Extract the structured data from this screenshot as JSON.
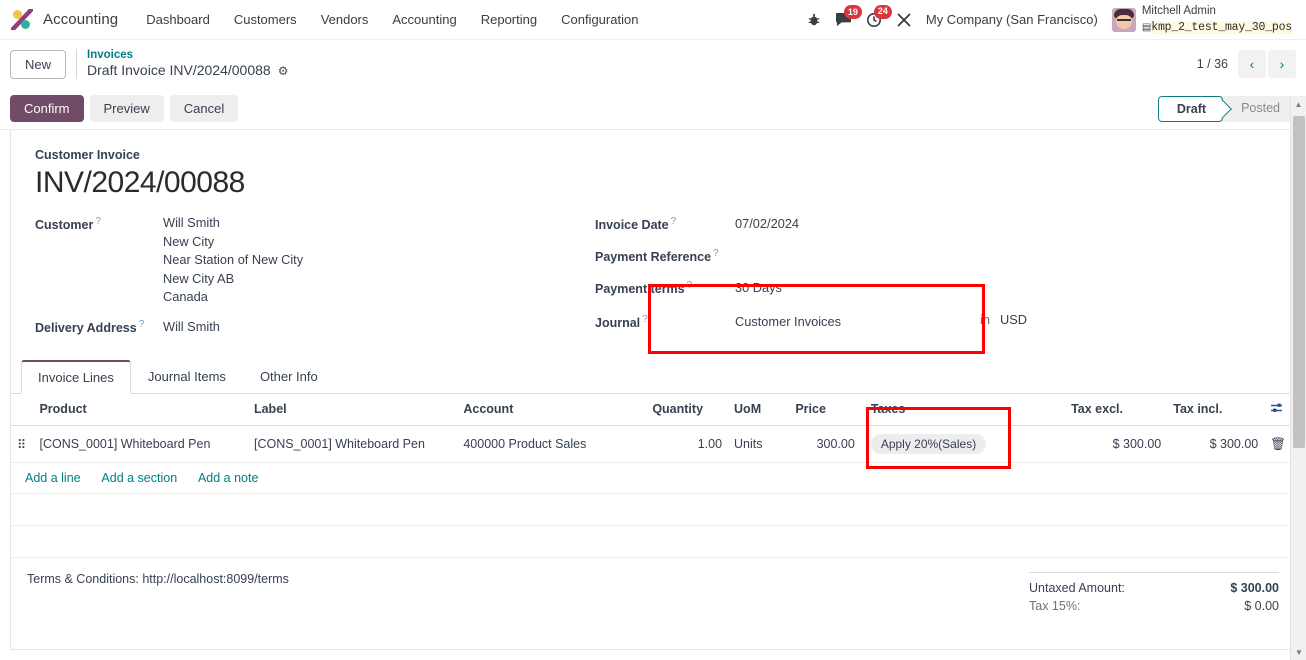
{
  "navbar": {
    "brand": "Accounting",
    "menu": [
      "Dashboard",
      "Customers",
      "Vendors",
      "Accounting",
      "Reporting",
      "Configuration"
    ],
    "icons": {
      "debug": "bug-icon",
      "messages": "chat-icon",
      "activities": "clock-icon",
      "tools": "wrench-icon"
    },
    "messages_count": "19",
    "activities_count": "24",
    "company": "My Company (San Francisco)",
    "user_name": "Mitchell Admin",
    "database": "kmp_2_test_may_30_pos"
  },
  "breadcrumb": {
    "new_label": "New",
    "parent": "Invoices",
    "current": "Draft Invoice INV/2024/00088",
    "settings_icon": "gear-icon"
  },
  "pager": {
    "count": "1 / 36",
    "prev_icon": "chevron-left-icon",
    "next_icon": "chevron-right-icon"
  },
  "actions": {
    "confirm": "Confirm",
    "preview": "Preview",
    "cancel": "Cancel"
  },
  "status": {
    "states": [
      "Draft",
      "Posted"
    ],
    "active": "Draft"
  },
  "invoice": {
    "doc_type": "Customer Invoice",
    "number": "INV/2024/00088",
    "customer_label": "Customer",
    "customer_lines": [
      "Will Smith",
      "New City",
      "Near Station of New City",
      "New City AB",
      "Canada"
    ],
    "delivery_label": "Delivery Address",
    "delivery_value": "Will Smith",
    "invoice_date_label": "Invoice Date",
    "invoice_date_value": "07/02/2024",
    "payment_reference_label": "Payment Reference",
    "payment_reference_value": "",
    "payment_terms_label": "Payment terms",
    "payment_terms_value": "30 Days",
    "journal_label": "Journal",
    "journal_value": "Customer Invoices",
    "currency_prefix": "in",
    "currency": "USD"
  },
  "notebook": {
    "tabs": [
      "Invoice Lines",
      "Journal Items",
      "Other Info"
    ],
    "active_tab": "Invoice Lines"
  },
  "lines_table": {
    "headers": [
      "Product",
      "Label",
      "Account",
      "Quantity",
      "UoM",
      "Price",
      "Taxes",
      "Tax excl.",
      "Tax incl."
    ],
    "optional_columns_icon": "sliders-icon",
    "rows": [
      {
        "drag_icon": "drag-handle-icon",
        "product": "[CONS_0001] Whiteboard Pen",
        "label": "[CONS_0001] Whiteboard Pen",
        "account": "400000 Product Sales",
        "quantity": "1.00",
        "uom": "Units",
        "price": "300.00",
        "taxes": "Apply 20%(Sales)",
        "tax_excl": "$ 300.00",
        "tax_incl": "$ 300.00",
        "delete_icon": "trash-icon"
      }
    ],
    "add_links": [
      "Add a line",
      "Add a section",
      "Add a note"
    ]
  },
  "footer": {
    "terms": "Terms & Conditions: http://localhost:8099/terms",
    "totals": [
      {
        "label": "Untaxed Amount:",
        "amount": "$ 300.00",
        "bold": true
      },
      {
        "label": "Tax 15%:",
        "amount": "$ 0.00",
        "bold": false
      }
    ]
  },
  "annotations": {
    "highlight_color": "#ff0000",
    "boxes": [
      "payment-terms-journal",
      "taxes-column"
    ]
  }
}
